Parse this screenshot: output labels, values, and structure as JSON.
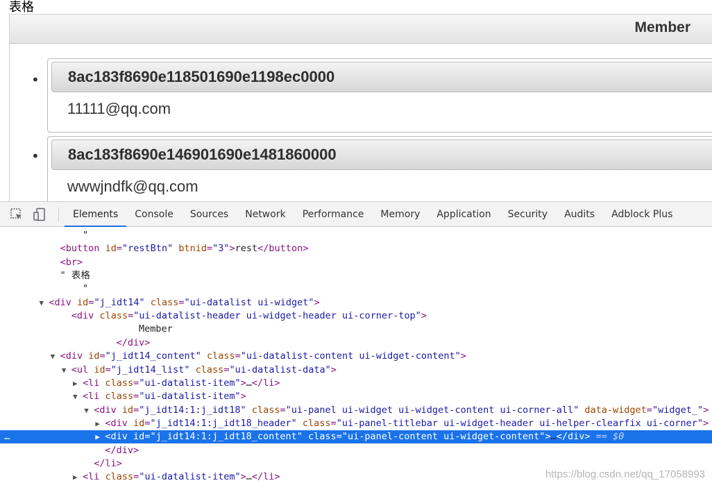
{
  "preview": {
    "heading": "表格",
    "header": "Member",
    "items": [
      {
        "title": "8ac183f8690e118501690e1198ec0000",
        "content": "11111@qq.com"
      },
      {
        "title": "8ac183f8690e146901690e1481860000",
        "content": "wwwjndfk@qq.com"
      }
    ]
  },
  "devtools": {
    "tabs": [
      "Elements",
      "Console",
      "Sources",
      "Network",
      "Performance",
      "Memory",
      "Application",
      "Security",
      "Audits",
      "Adblock Plus"
    ],
    "active_tab": "Elements",
    "icons": [
      "inspect-element-icon",
      "device-toggle-icon"
    ],
    "lines": [
      {
        "indent": 5,
        "text": "\""
      },
      {
        "indent": 3,
        "tag": "button",
        "attrs": [
          [
            "id",
            "restBtn"
          ],
          [
            "btnid",
            "3"
          ]
        ],
        "inner": "rest",
        "close": "button"
      },
      {
        "indent": 3,
        "tag": "br"
      },
      {
        "indent": 3,
        "text": "\" 表格"
      },
      {
        "indent": 5,
        "text": "\""
      },
      {
        "indent": 2,
        "tw": "▼",
        "tag": "div",
        "attrs": [
          [
            "id",
            "j_idt14"
          ],
          [
            "class",
            "ui-datalist ui-widget"
          ]
        ]
      },
      {
        "indent": 4,
        "tag": "div",
        "attrs": [
          [
            "class",
            "ui-datalist-header ui-widget-header ui-corner-top"
          ]
        ]
      },
      {
        "indent": 10,
        "text": "Member"
      },
      {
        "indent": 8,
        "closing": "div"
      },
      {
        "indent": 3,
        "tw": "▼",
        "tag": "div",
        "attrs": [
          [
            "id",
            "j_idt14_content"
          ],
          [
            "class",
            "ui-datalist-content ui-widget-content"
          ]
        ]
      },
      {
        "indent": 4,
        "tw": "▼",
        "tag": "ul",
        "attrs": [
          [
            "id",
            "j_idt14_list"
          ],
          [
            "class",
            "ui-datalist-data"
          ]
        ]
      },
      {
        "indent": 5,
        "tw": "▶",
        "tag": "li",
        "attrs": [
          [
            "class",
            "ui-datalist-item"
          ]
        ],
        "inner": "…",
        "close": "li"
      },
      {
        "indent": 5,
        "tw": "▼",
        "tag": "li",
        "attrs": [
          [
            "class",
            "ui-datalist-item"
          ]
        ]
      },
      {
        "indent": 6,
        "tw": "▼",
        "tag": "div",
        "attrs": [
          [
            "id",
            "j_idt14:1:j_idt18"
          ],
          [
            "class",
            "ui-panel ui-widget ui-widget-content ui-corner-all"
          ],
          [
            "data-widget",
            "widget_"
          ]
        ]
      },
      {
        "indent": 7,
        "tw": "▶",
        "tag": "div",
        "attrs": [
          [
            "id",
            "j_idt14:1:j_idt18_header"
          ],
          [
            "class",
            "ui-panel-titlebar ui-widget-header ui-helper-clearfix ui-corner"
          ]
        ]
      },
      {
        "indent": 7,
        "tw": "▶",
        "tag": "div",
        "attrs": [
          [
            "id",
            "j_idt14:1:j_idt18_content"
          ],
          [
            "class",
            "ui-panel-content ui-widget-content"
          ]
        ],
        "inner": "…",
        "close": "div",
        "selected": true,
        "suffix": " == $0"
      },
      {
        "indent": 7,
        "closing": "div"
      },
      {
        "indent": 6,
        "closing": "li"
      },
      {
        "indent": 5,
        "tw": "▶",
        "tag": "li",
        "attrs": [
          [
            "class",
            "ui-datalist-item"
          ]
        ],
        "inner": "…",
        "close": "li"
      }
    ],
    "selected_ellipsis": "…",
    "watermark": "https://blog.csdn.net/qq_17058993"
  }
}
